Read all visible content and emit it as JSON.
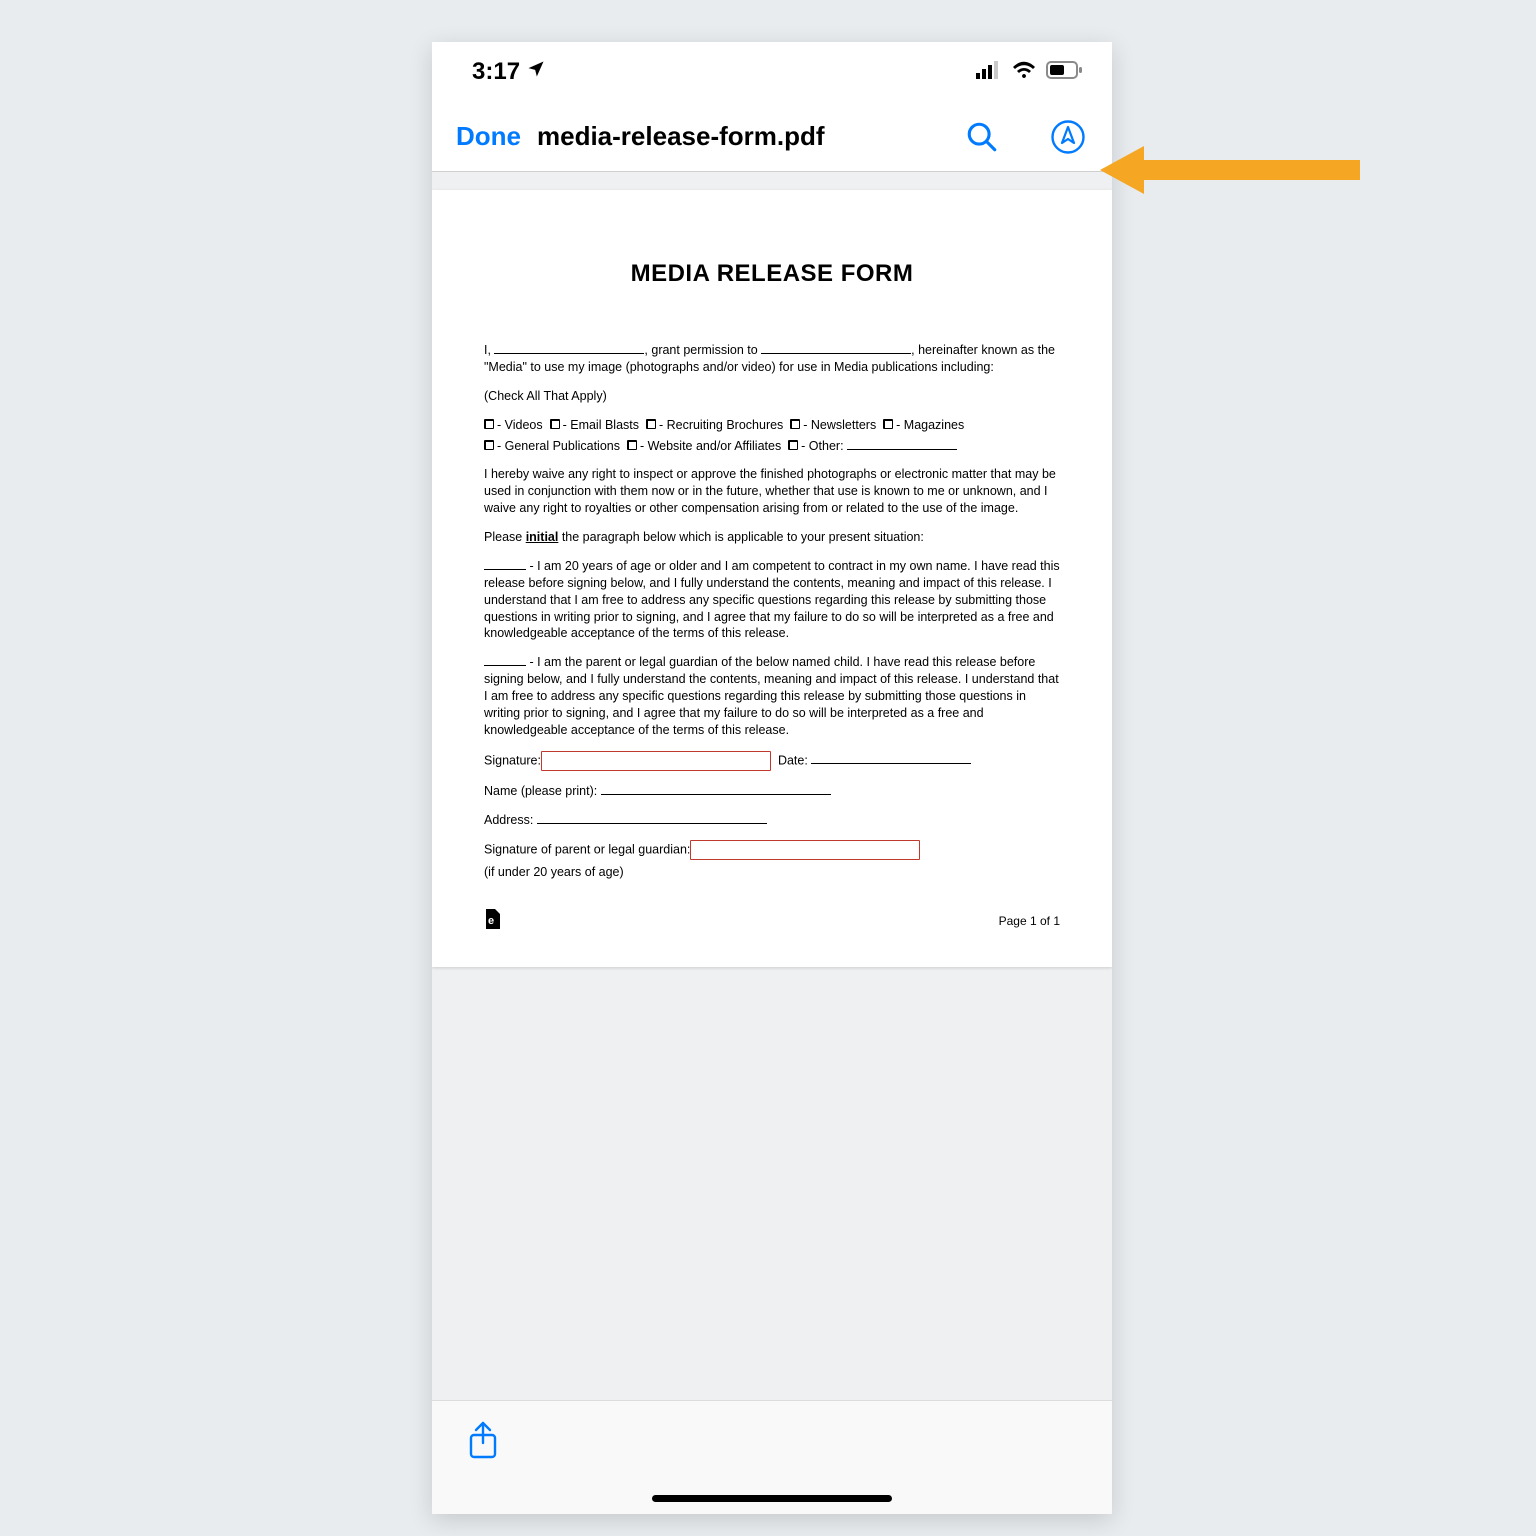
{
  "statusbar": {
    "time": "3:17"
  },
  "navbar": {
    "done": "Done",
    "title": "media-release-form.pdf"
  },
  "doc": {
    "heading": "MEDIA RELEASE FORM",
    "intro_1": "I, ",
    "intro_2": ", grant permission to ",
    "intro_3": ", hereinafter known as the \"Media\" to use my image (photographs and/or video) for use in Media publications including:",
    "checkall": "(Check All That Apply)",
    "opts": {
      "videos": "- Videos",
      "email": "- Email Blasts",
      "recruiting": "- Recruiting Brochures",
      "newsletters": "- Newsletters",
      "magazines": "- Magazines",
      "general": "- General Publications",
      "website": "- Website and/or Affiliates",
      "other": "- Other:"
    },
    "waive": "I hereby waive any right to inspect or approve the finished photographs or electronic matter that may be used in conjunction with them now or in the future, whether that use is known to me or unknown, and I waive any right to royalties or other compensation arising from or related to the use of the image.",
    "please_pre": "Please ",
    "please_bold": "initial",
    "please_post": " the paragraph below which is applicable to your present situation:",
    "para_adult": " - I am 20 years of age or older and I am competent to contract in my own name. I have read this release before signing below, and I fully understand the contents, meaning and impact of this release. I understand that I am free to address any specific questions regarding this release by submitting those questions in writing prior to signing, and I agree that my failure to do so will be interpreted as a free and knowledgeable acceptance of the terms of this release.",
    "para_guardian": " - I am the parent or legal guardian of the below named child. I have read this release before signing below, and I fully understand the contents, meaning and impact of this release. I understand that I am free to address any specific questions regarding this release by submitting those questions in writing prior to signing, and I agree that my failure to do so will be interpreted as a free and knowledgeable acceptance of the terms of this release.",
    "sig_label": "Signature:",
    "date_label": "Date: ",
    "name_label": "Name (please print): ",
    "address_label": "Address: ",
    "guardian_sig_label": "Signature of parent or legal guardian:",
    "under20": "(if under 20 years of age)",
    "page_num": "Page 1 of 1"
  }
}
